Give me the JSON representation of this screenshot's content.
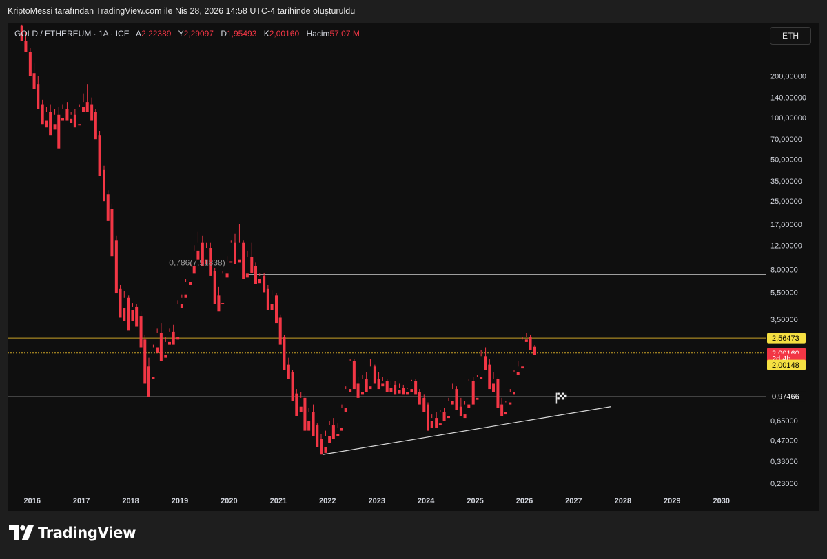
{
  "header": {
    "attribution": "KriptoMessi tarafından TradingView.com ile Nis 28, 2026 14:58 UTC-4 tarihinde oluşturuldu"
  },
  "legend": {
    "symbol": "GOLD / ETHEREUM · 1A · ICE",
    "open_label": "A",
    "open_value": "2,22389",
    "high_label": "Y",
    "high_value": "2,29097",
    "low_label": "D",
    "low_value": "1,95493",
    "close_label": "K",
    "close_value": "2,00160",
    "volume_label": "Hacim",
    "volume_value": "57,07 M"
  },
  "currency_button": "ETH",
  "brand": "TradingView",
  "colors": {
    "up": "#089981",
    "down": "#f23645",
    "level": "#c9a227",
    "price_badge": "#f23645"
  },
  "chart_data": {
    "type": "candlestick",
    "scale": "log",
    "x_ticks": [
      "2016",
      "2017",
      "2018",
      "2019",
      "2020",
      "2021",
      "2022",
      "2023",
      "2024",
      "2025",
      "2026",
      "2027",
      "2028",
      "2029",
      "2030"
    ],
    "y_ticks": [
      "200,00000",
      "140,00000",
      "100,00000",
      "70,00000",
      "50,00000",
      "35,00000",
      "25,00000",
      "17,00000",
      "12,00000",
      "8,00000",
      "5,50000",
      "3,50000",
      "0,65000",
      "0,47000",
      "0,33000",
      "0,23000"
    ],
    "y_tick_values": [
      200,
      140,
      100,
      70,
      50,
      35,
      25,
      17,
      12,
      8,
      5.5,
      3.5,
      0.65,
      0.47,
      0.33,
      0.23
    ],
    "ylim": [
      0.2,
      480
    ],
    "xlim": [
      2015.5,
      2030.9
    ],
    "price_labels": [
      {
        "text": "2,56473",
        "value": 2.56473,
        "style": "level"
      },
      {
        "text": "2,00160",
        "value": 2.0016,
        "style": "current"
      },
      {
        "text": "2d 4h",
        "value": 1.83,
        "style": "current-sub"
      },
      {
        "text": "2,00148",
        "value": 1.64,
        "style": "level"
      },
      {
        "text": "0,97466",
        "value": 0.97466,
        "style": "dark"
      }
    ],
    "horizontal_lines": [
      {
        "value": 7.4,
        "x_start": 2020.35,
        "color": "#9e9e9e"
      },
      {
        "value": 2.56473,
        "x_start": 2015.5,
        "color": "#c9a227"
      },
      {
        "value": 2.0016,
        "x_start": 2015.5,
        "color": "#c9a227",
        "dashed": true
      },
      {
        "value": 0.97466,
        "x_start": 2015.5,
        "color": "#4a4a4a"
      }
    ],
    "annotation": {
      "text": "0,786(7,51838)",
      "x": 2019.35,
      "y": 8.6
    },
    "trendline": {
      "x1": 2021.9,
      "y1": 0.37,
      "x2": 2027.75,
      "y2": 0.82
    },
    "target_flag": {
      "x": 2026.65,
      "y": 0.88
    },
    "candles": [
      [
        2015.79,
        460,
        470,
        380,
        360
      ],
      [
        2015.87,
        360,
        420,
        300,
        300
      ],
      [
        2015.96,
        300,
        320,
        210,
        200
      ],
      [
        2016.04,
        210,
        250,
        170,
        160
      ],
      [
        2016.12,
        175,
        200,
        125,
        115
      ],
      [
        2016.21,
        125,
        135,
        95,
        90
      ],
      [
        2016.29,
        95,
        120,
        110,
        85
      ],
      [
        2016.37,
        110,
        125,
        90,
        75
      ],
      [
        2016.46,
        90,
        115,
        105,
        82
      ],
      [
        2016.54,
        105,
        120,
        100,
        60
      ],
      [
        2016.62,
        100,
        125,
        115,
        95
      ],
      [
        2016.71,
        115,
        130,
        98,
        95
      ],
      [
        2016.79,
        98,
        110,
        105,
        92
      ],
      [
        2016.87,
        105,
        115,
        90,
        85
      ],
      [
        2016.96,
        90,
        125,
        120,
        88
      ],
      [
        2017.04,
        120,
        150,
        130,
        110
      ],
      [
        2017.12,
        130,
        175,
        125,
        110
      ],
      [
        2017.21,
        125,
        140,
        110,
        95
      ],
      [
        2017.29,
        110,
        115,
        75,
        70
      ],
      [
        2017.37,
        75,
        80,
        42,
        38
      ],
      [
        2017.46,
        42,
        45,
        28,
        25
      ],
      [
        2017.54,
        28,
        30,
        22,
        18
      ],
      [
        2017.62,
        22,
        24,
        13,
        10
      ],
      [
        2017.71,
        13,
        14,
        5.8,
        5.4
      ],
      [
        2017.79,
        5.8,
        6.2,
        4.2,
        3.6
      ],
      [
        2017.87,
        4.2,
        5.6,
        5,
        3.4
      ],
      [
        2017.96,
        5,
        5.2,
        4.1,
        2.9
      ],
      [
        2018.04,
        4.1,
        4.6,
        4.3,
        3.4
      ],
      [
        2018.12,
        4.3,
        4.5,
        3.7,
        3.1
      ],
      [
        2018.21,
        3.7,
        4,
        2.5,
        2.2
      ],
      [
        2018.29,
        2.5,
        2.7,
        1.6,
        1.2
      ],
      [
        2018.37,
        1.6,
        1.85,
        1.35,
        0.97
      ],
      [
        2018.46,
        1.35,
        2.3,
        2.2,
        1.3
      ],
      [
        2018.54,
        2.2,
        3,
        2.8,
        2
      ],
      [
        2018.62,
        2.8,
        3.3,
        1.95,
        1.75
      ],
      [
        2018.71,
        1.95,
        2.6,
        2.4,
        1.85
      ],
      [
        2018.79,
        2.4,
        3,
        2.85,
        2.3
      ],
      [
        2018.87,
        2.85,
        3.2,
        2.6,
        2.3
      ],
      [
        2018.96,
        2.6,
        4.8,
        4.5,
        2.5
      ],
      [
        2019.04,
        4.5,
        5,
        5.3,
        4.2
      ],
      [
        2019.12,
        5.3,
        6.8,
        6.5,
        5
      ],
      [
        2019.21,
        6.5,
        8.8,
        8.5,
        6.2
      ],
      [
        2019.29,
        8.5,
        12,
        11,
        7.5
      ],
      [
        2019.37,
        11,
        15,
        12.5,
        9.5
      ],
      [
        2019.46,
        12.5,
        14,
        9.5,
        8.5
      ],
      [
        2019.54,
        9.5,
        12.5,
        11.5,
        8.8
      ],
      [
        2019.62,
        11.5,
        12.5,
        7.8,
        7.2
      ],
      [
        2019.71,
        7.8,
        8.2,
        5.2,
        4.5
      ],
      [
        2019.79,
        5.2,
        6,
        4.6,
        4
      ],
      [
        2019.87,
        4.6,
        7.8,
        7.5,
        4.5
      ],
      [
        2019.96,
        7.5,
        10,
        9.2,
        7
      ],
      [
        2020.04,
        9.2,
        13,
        12.5,
        9
      ],
      [
        2020.12,
        12.5,
        14.5,
        9.5,
        8.8
      ],
      [
        2020.21,
        9.5,
        17,
        12.5,
        9
      ],
      [
        2020.29,
        12.5,
        13,
        7.5,
        6.8
      ],
      [
        2020.37,
        7.5,
        11,
        9.8,
        7
      ],
      [
        2020.46,
        9.8,
        12.5,
        8.5,
        7.6
      ],
      [
        2020.54,
        8.5,
        9,
        6.8,
        6.3
      ],
      [
        2020.62,
        6.8,
        7.5,
        7.2,
        6.4
      ],
      [
        2020.71,
        7.2,
        7.6,
        5.8,
        5.5
      ],
      [
        2020.79,
        5.8,
        6.2,
        4.5,
        4.1
      ],
      [
        2020.87,
        4.5,
        5.7,
        5.2,
        4.1
      ],
      [
        2020.96,
        5.2,
        5.4,
        3.6,
        3.3
      ],
      [
        2021.04,
        3.6,
        3.8,
        2.6,
        2.3
      ],
      [
        2021.12,
        2.6,
        2.7,
        1.65,
        1.5
      ],
      [
        2021.21,
        1.65,
        1.85,
        1.45,
        1.3
      ],
      [
        2021.29,
        1.45,
        1.5,
        1.02,
        0.9
      ],
      [
        2021.37,
        1.02,
        1.1,
        0.82,
        0.7
      ],
      [
        2021.46,
        0.82,
        1.05,
        0.95,
        0.75
      ],
      [
        2021.54,
        0.95,
        1,
        0.65,
        0.55
      ],
      [
        2021.62,
        0.65,
        0.8,
        0.75,
        0.55
      ],
      [
        2021.71,
        0.75,
        0.85,
        0.6,
        0.5
      ],
      [
        2021.79,
        0.6,
        0.62,
        0.48,
        0.42
      ],
      [
        2021.87,
        0.48,
        0.52,
        0.42,
        0.37
      ],
      [
        2021.96,
        0.42,
        0.55,
        0.5,
        0.38
      ],
      [
        2022.04,
        0.5,
        0.65,
        0.6,
        0.45
      ],
      [
        2022.12,
        0.6,
        0.68,
        0.52,
        0.48
      ],
      [
        2022.21,
        0.52,
        0.62,
        0.58,
        0.5
      ],
      [
        2022.29,
        0.58,
        0.85,
        0.8,
        0.55
      ],
      [
        2022.37,
        0.8,
        1.15,
        1.1,
        0.75
      ],
      [
        2022.46,
        1.1,
        1.8,
        1.75,
        1.05
      ],
      [
        2022.54,
        1.75,
        1.8,
        1.2,
        1.1
      ],
      [
        2022.62,
        1.2,
        1.35,
        1.05,
        0.95
      ],
      [
        2022.71,
        1.05,
        1.4,
        1.3,
        1
      ],
      [
        2022.79,
        1.3,
        1.45,
        1.15,
        1.05
      ],
      [
        2022.87,
        1.15,
        1.8,
        1.6,
        1.1
      ],
      [
        2022.96,
        1.6,
        1.65,
        1.3,
        1.2
      ],
      [
        2023.04,
        1.3,
        1.45,
        1.2,
        1.1
      ],
      [
        2023.12,
        1.2,
        1.35,
        1.25,
        1.15
      ],
      [
        2023.21,
        1.25,
        1.3,
        1.12,
        1.05
      ],
      [
        2023.29,
        1.12,
        1.25,
        1.18,
        1.05
      ],
      [
        2023.37,
        1.18,
        1.25,
        1.08,
        1
      ],
      [
        2023.46,
        1.08,
        1.2,
        1.12,
        1.02
      ],
      [
        2023.54,
        1.12,
        1.18,
        1.05,
        1
      ],
      [
        2023.62,
        1.05,
        1.12,
        1.1,
        1
      ],
      [
        2023.71,
        1.1,
        1.28,
        1.25,
        1.05
      ],
      [
        2023.79,
        1.25,
        1.3,
        1.05,
        1
      ],
      [
        2023.87,
        1.05,
        1.1,
        0.95,
        0.85
      ],
      [
        2023.96,
        0.95,
        1,
        0.85,
        0.75
      ],
      [
        2024.04,
        0.85,
        0.88,
        0.65,
        0.55
      ],
      [
        2024.12,
        0.65,
        0.72,
        0.68,
        0.58
      ],
      [
        2024.21,
        0.68,
        0.75,
        0.62,
        0.58
      ],
      [
        2024.29,
        0.62,
        0.78,
        0.75,
        0.6
      ],
      [
        2024.37,
        0.75,
        0.8,
        0.7,
        0.65
      ],
      [
        2024.46,
        0.7,
        0.95,
        0.9,
        0.68
      ],
      [
        2024.54,
        0.9,
        1.2,
        1.1,
        0.85
      ],
      [
        2024.62,
        1.1,
        1.15,
        0.82,
        0.78
      ],
      [
        2024.71,
        0.82,
        0.95,
        0.72,
        0.7
      ],
      [
        2024.79,
        0.72,
        0.9,
        0.85,
        0.68
      ],
      [
        2024.87,
        0.85,
        1.3,
        1.25,
        0.8
      ],
      [
        2024.96,
        1.25,
        1.35,
        0.95,
        0.85
      ],
      [
        2025.04,
        0.95,
        1.4,
        1.35,
        0.92
      ],
      [
        2025.12,
        1.35,
        2.1,
        1.9,
        1.3
      ],
      [
        2025.21,
        1.9,
        2.2,
        1.65,
        1.5
      ],
      [
        2025.29,
        1.65,
        1.8,
        1.2,
        1.1
      ],
      [
        2025.37,
        1.2,
        1.45,
        1.3,
        1.05
      ],
      [
        2025.46,
        1.3,
        1.35,
        0.85,
        0.8
      ],
      [
        2025.54,
        0.85,
        0.95,
        0.75,
        0.7
      ],
      [
        2025.62,
        0.75,
        0.9,
        0.88,
        0.72
      ],
      [
        2025.71,
        0.88,
        1.1,
        1.05,
        0.85
      ],
      [
        2025.79,
        1.05,
        1.5,
        1.45,
        1
      ],
      [
        2025.87,
        1.45,
        1.75,
        1.6,
        1.4
      ],
      [
        2025.96,
        1.6,
        2.6,
        2.5,
        1.55
      ],
      [
        2026.04,
        2.5,
        2.8,
        2.6,
        2.4
      ],
      [
        2026.12,
        2.6,
        2.72,
        2.2,
        2.1
      ],
      [
        2026.21,
        2.22,
        2.29,
        2.0,
        1.95
      ]
    ]
  }
}
